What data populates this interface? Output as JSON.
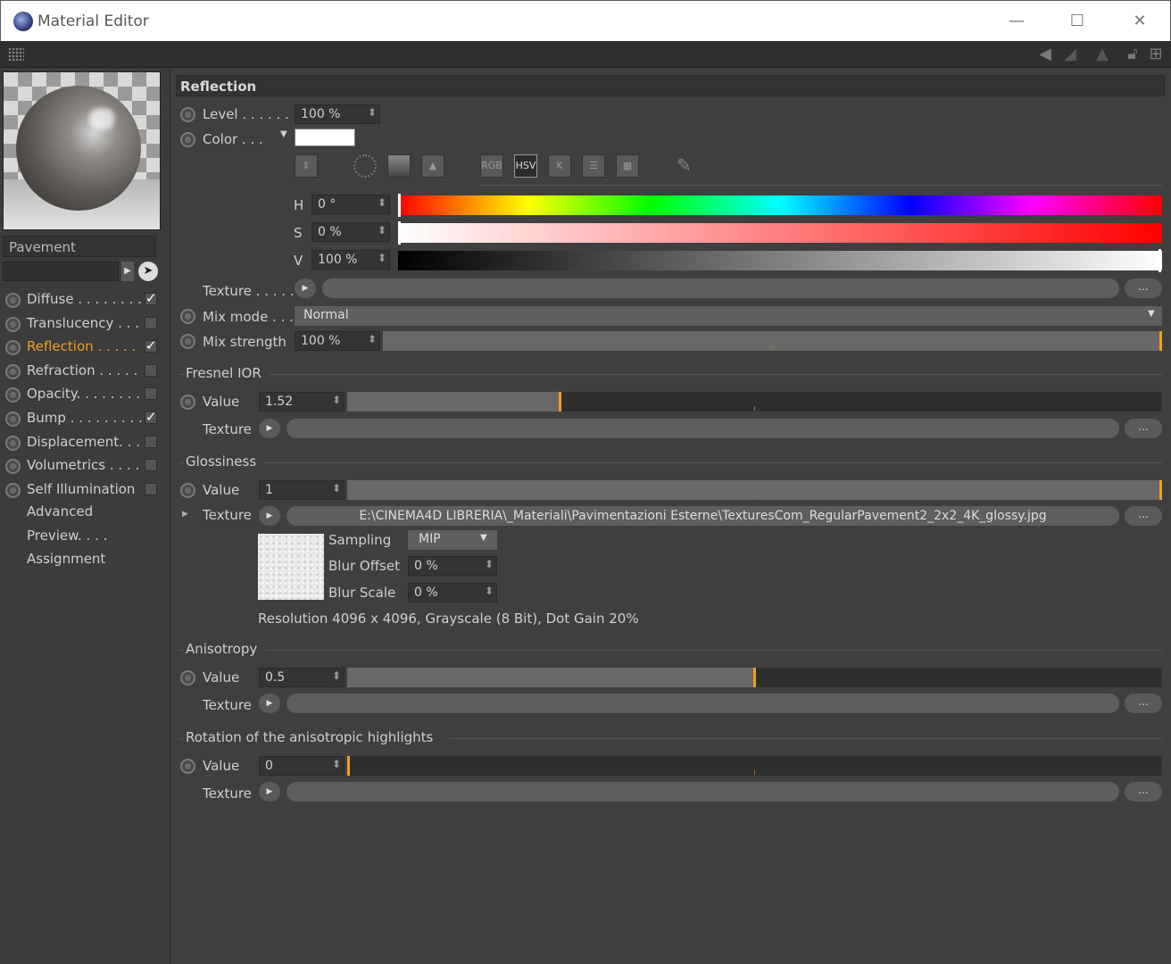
{
  "window": {
    "title": "Material Editor",
    "minimize": "—",
    "maximize": "☐",
    "close": "✕"
  },
  "preview": {
    "material_name": "Pavement"
  },
  "channels": [
    {
      "label": "Diffuse . . . . . . . .",
      "checked": "✓"
    },
    {
      "label": "Translucency . . .",
      "checked": ""
    },
    {
      "label": "Reflection . . . . .",
      "checked": "✓"
    },
    {
      "label": "Refraction . . . . .",
      "checked": ""
    },
    {
      "label": "Opacity. . . . . . . .",
      "checked": ""
    },
    {
      "label": "Bump . . . . . . . . .",
      "checked": "✓"
    },
    {
      "label": "Displacement. . .",
      "checked": ""
    },
    {
      "label": "Volumetrics . . . .",
      "checked": ""
    },
    {
      "label": "Self Illumination",
      "checked": ""
    }
  ],
  "nav": [
    "Advanced",
    "Preview. . . .",
    "Assignment"
  ],
  "section": {
    "title": "Reflection"
  },
  "level": {
    "label": "Level . . . . . . .",
    "value": "100 %"
  },
  "color": {
    "label": "Color . . .",
    "swatch": "#ffffff"
  },
  "color_tools": {
    "rgb": "RGB",
    "hsv": "HSV",
    "k": "K"
  },
  "hsv": {
    "h": {
      "label": "H",
      "value": "0 °"
    },
    "s": {
      "label": "S",
      "value": "0 %"
    },
    "v": {
      "label": "V",
      "value": "100 %"
    }
  },
  "texture_label": "Texture . . . . .",
  "mix_mode": {
    "label": "Mix mode . . .",
    "value": "Normal"
  },
  "mix_strength": {
    "label": "Mix strength",
    "value": "100 %",
    "level": 1.0
  },
  "fresnel": {
    "group": "Fresnel IOR",
    "value_label": "Value",
    "value": "1.52",
    "level": 0.26,
    "texture_label": "Texture"
  },
  "glossiness": {
    "group": "Glossiness",
    "value_label": "Value",
    "value": "1",
    "level": 1.0,
    "texture_label": "Texture",
    "texture_path": "E:\\CINEMA4D LIBRERIA\\_Materiali\\Pavimentazioni Esterne\\TexturesCom_RegularPavement2_2x2_4K_glossy.jpg",
    "sampling_label": "Sampling",
    "sampling": "MIP",
    "blur_offset_label": "Blur Offset",
    "blur_offset": "0 %",
    "blur_scale_label": "Blur Scale",
    "blur_scale": "0 %",
    "resolution": "Resolution 4096 x 4096, Grayscale (8 Bit), Dot Gain 20%"
  },
  "anisotropy": {
    "group": "Anisotropy",
    "value_label": "Value",
    "value": "0.5",
    "level": 0.5,
    "texture_label": "Texture"
  },
  "rotation": {
    "group": "Rotation of the anisotropic highlights",
    "value_label": "Value",
    "value": "0",
    "level": 0.0,
    "texture_label": "Texture"
  },
  "dots": "...",
  "colors": {
    "accent": "#f0a020",
    "panel": "#3f3f3f"
  }
}
